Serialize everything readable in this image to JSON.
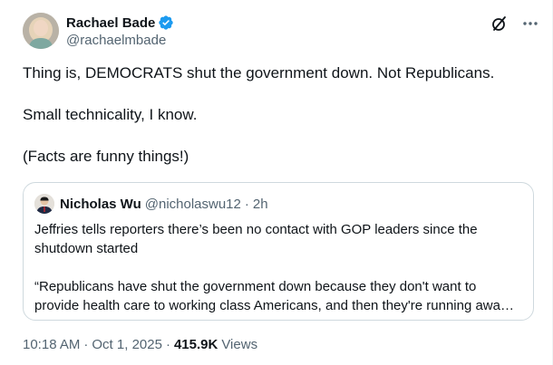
{
  "author": {
    "display_name": "Rachael Bade",
    "handle": "@rachaelmbade",
    "verified": true
  },
  "header_icons": [
    "grok-icon",
    "more-icon"
  ],
  "tweet": {
    "paragraphs": [
      "Thing is, DEMOCRATS shut the government down. Not Republicans.",
      "Small technicality, I know.",
      "(Facts are funny things!)"
    ]
  },
  "quoted_tweet": {
    "display_name": "Nicholas Wu",
    "handle": "@nicholaswu12",
    "dot": "·",
    "time": "2h",
    "paragraph_1": "Jeffries tells reporters there’s been no contact with GOP leaders since the shutdown started",
    "paragraph_2": "“Republicans have shut the government down because they don't want to provide health care to working class Americans, and then they're running away from Washington, D.C.”"
  },
  "meta": {
    "time": "10:18 AM",
    "sep": "·",
    "date": "Oct 1, 2025",
    "views_count": "415.9K",
    "views_label": "Views"
  },
  "colors": {
    "verified_blue": "#1d9bf0",
    "text_primary": "#0f1419",
    "text_secondary": "#536471",
    "border": "#cfd9de"
  }
}
